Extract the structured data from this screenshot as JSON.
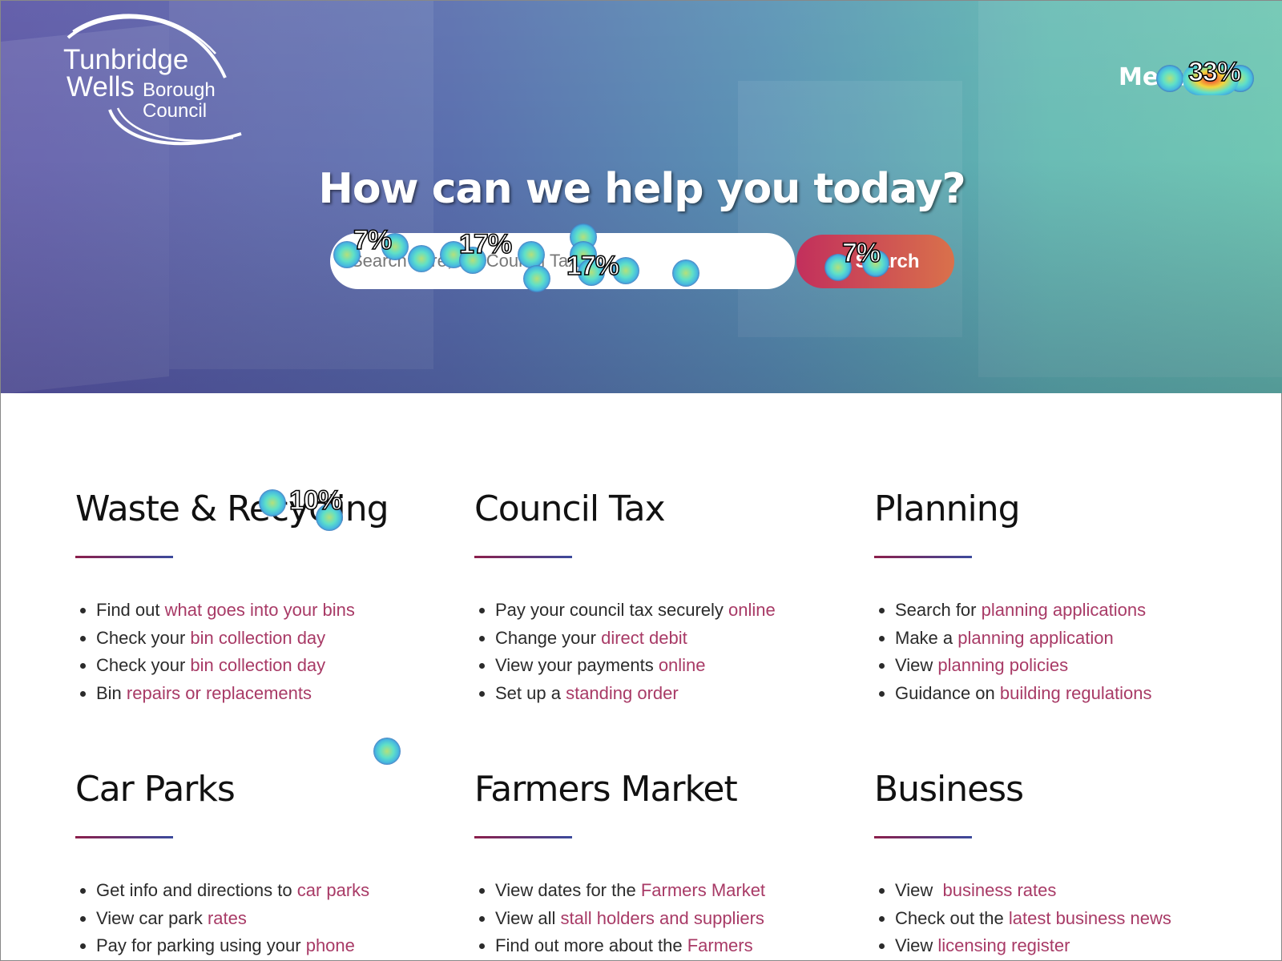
{
  "header": {
    "logo": {
      "line1": "Tunbridge",
      "line2": "Wells",
      "line3": "Borough",
      "line4": "Council"
    },
    "menu_label": "Menu",
    "headline": "How can we help you today?",
    "search": {
      "placeholder": "Search here, eg. Council Tax",
      "button_label": "Search",
      "button_icon": "search-icon"
    }
  },
  "colors": {
    "link": "#a83a66",
    "accent_from": "#c22f5c",
    "accent_to": "#d9714b",
    "rule_from": "#8c1f4b",
    "rule_to": "#3b4a9c"
  },
  "sections": [
    {
      "title": "Waste & Recycling",
      "items": [
        {
          "text": "Find out ",
          "link": "what goes into your bins"
        },
        {
          "text": "Check your ",
          "link": "bin collection day"
        },
        {
          "text": "Check your ",
          "link": "bin collection day"
        },
        {
          "text": "Bin ",
          "link": "repairs or replacements"
        }
      ]
    },
    {
      "title": "Council Tax",
      "items": [
        {
          "text": "Pay your council tax securely ",
          "link": "online"
        },
        {
          "text": "Change your ",
          "link": "direct debit"
        },
        {
          "text": "View your payments ",
          "link": "online"
        },
        {
          "text": "Set up a ",
          "link": "standing order"
        }
      ]
    },
    {
      "title": "Planning",
      "items": [
        {
          "text": "Search for ",
          "link": "planning applications"
        },
        {
          "text": "Make a ",
          "link": "planning application"
        },
        {
          "text": "View ",
          "link": "planning policies"
        },
        {
          "text": "Guidance on ",
          "link": "building regulations"
        }
      ]
    },
    {
      "title": "Car Parks",
      "items": [
        {
          "text": "Get info and directions to ",
          "link": "car parks"
        },
        {
          "text": "View car park ",
          "link": "rates"
        },
        {
          "text": "Pay for parking using your ",
          "link": "phone"
        }
      ]
    },
    {
      "title": "Farmers Market",
      "items": [
        {
          "text": "View dates for the ",
          "link": "Farmers Market"
        },
        {
          "text": "View all ",
          "link": "stall holders and suppliers"
        },
        {
          "text": "Find out more about the ",
          "link": "Farmers"
        }
      ]
    },
    {
      "title": "Business",
      "items": [
        {
          "text": "View  ",
          "link": "business rates"
        },
        {
          "text": "Check out the ",
          "link": "latest business news"
        },
        {
          "text": "View ",
          "link": "licensing register"
        }
      ]
    }
  ],
  "heatmap": {
    "labels": [
      "7%",
      "17%",
      "17%",
      "7%",
      "33%",
      "10%"
    ]
  }
}
